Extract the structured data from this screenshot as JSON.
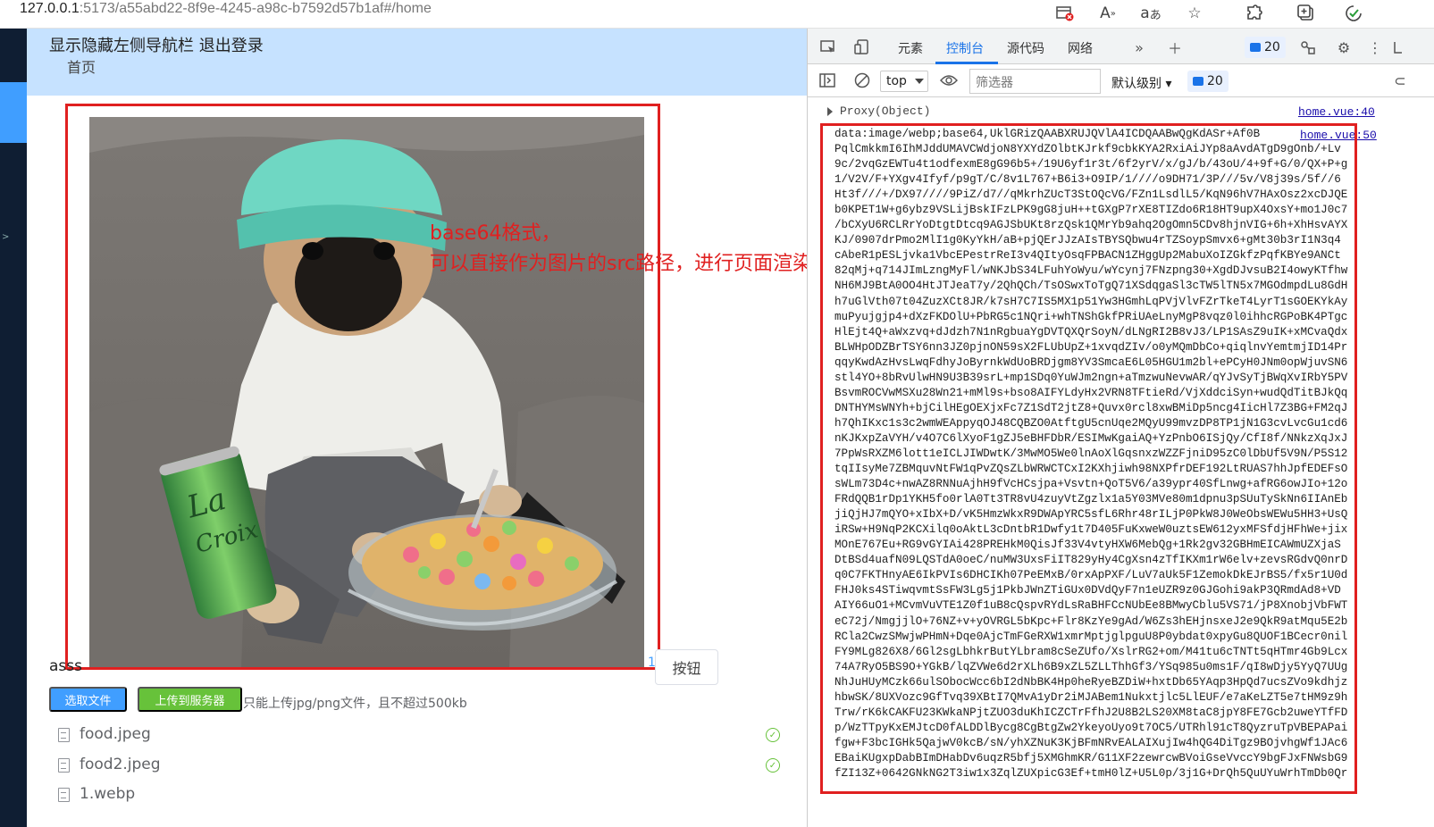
{
  "browser": {
    "url_host": "127.0.0.1",
    "url_rest": ":5173/a55abd22-8f9e-4245-a98c-b7592d57b1af#/home",
    "toolbar_icons": [
      "tab-close-icon",
      "read-aloud-icon",
      "translate-icon",
      "favorite-star-icon",
      "extensions-icon",
      "add-tab-icon",
      "browser-essentials-icon"
    ]
  },
  "app": {
    "header": {
      "toggle_nav": "显示隐藏左侧导航栏",
      "logout": "退出登录",
      "breadcrumb": "首页"
    },
    "caption_left": "asss",
    "caption_right": "1",
    "button_label": "按钮",
    "select_file_label": "选取文件",
    "upload_label": "上传到服务器",
    "upload_tip": "只能上传jpg/png文件，且不超过500kb",
    "files": [
      {
        "name": "food.jpeg",
        "status": "success"
      },
      {
        "name": "food2.jpeg",
        "status": "success"
      },
      {
        "name": "1.webp",
        "status": ""
      }
    ]
  },
  "annotations": {
    "left_line1": "base64格式，",
    "left_line2": "可以直接作为图片的src路径，进行页面渲染"
  },
  "devtools": {
    "tabs": [
      "元素",
      "控制台",
      "源代码",
      "网络"
    ],
    "active_tab": "控制台",
    "issue_count": "20",
    "context": "top",
    "filter_placeholder": "筛选器",
    "level": "默认级别",
    "message_count": "20",
    "log1_text": "Proxy(Object)",
    "log1_source": "home.vue:40",
    "log2_source": "home.vue:50",
    "base64_lines": [
      "data:image/webp;base64,UklGRizQAABXRUJQVlA4ICDQAABwQgKdASr+Af0B",
      "PqlCmkkmI6IhMJddUMAVCWdjoN8YXYdZOlbtKJrkf9cbkKYA2RxiAiJYp8aAvdATgD9gOnb/+Lv",
      "9c/2vqGzEWTu4t1odfexmE8gG96b5+/19U6yf1r3t/6f2yrV/x/gJ/b/43oU/4+9f+G/0/QX+P+g",
      "1/V2V/F+YXgv4Ifyf/p9gT/C/8v1L767+B6i3+O9IP/1////o9DH71/3P///5v/V8j39s/5f//6",
      "Ht3f///+/DX97////9PiZ/d7//qMkrhZUcT3StOQcVG/FZn1LsdlL5/KqN96hV7HAxOsz2xcDJQE",
      "b0KPET1W+g6ybz9VSLijBskIFzLPK9gG8juH++tGXgP7rXE8TIZdo6R18HT9upX4OxsY+mo1J0c7",
      "/bCXyU6RCLRrYoDtgtDtcq9AGJSbUKt8rzQsk1QMrYb9ahq2OgOmn5CDv8hjnVIG+6h+XhHsvAYX",
      "KJ/0907drPmo2MlI1g0KyYkH/aB+pjQErJJzAIsTBYSQbwu4rTZSoypSmvx6+gMt30b3rI1N3q4",
      "cAbeR1pESLjvka1VbcEPestrReI3v4QItyOsqFPBACN1ZHggUp2MabuXoIZGkfzPqfKBYe9ANCt",
      "82qMj+q714JImLzngMyFl/wNKJbS34LFuhYoWyu/wYcynj7FNzpng30+XgdDJvsuB2I4owyKTfhw",
      "NH6MJ9BtA0OO4HtJTJeaT7y/2QhQCh/TsOSwxToTgQ71XSdqgaSl3cTW5lTN5x7MGOdmpdLu8GdH",
      "h7uGlVth07t04ZuzXCt8JR/k7sH7C7IS5MX1p51Yw3HGmhLqPVjVlvFZrTkeT4LyrT1sGOEKYkAy",
      "muPyujgjp4+dXzFKDOlU+PbRG5c1NQri+whTNShGkfPRiUAeLnyMgP8vqz0l0ihhcRGPoBK4PTgc",
      "HlEjt4Q+aWxzvq+dJdzh7N1nRgbuaYgDVTQXQrSoyN/dLNgRI2B8vJ3/LP1SAsZ9uIK+xMCvaQdx",
      "BLWHpODZBrTSY6nn3JZ0pjnON59sX2FLUbUpZ+1xvqdZIv/o0yMQmDbCo+qiqlnvYemtmjID14Pr",
      "qqyKwdAzHvsLwqFdhyJoByrnkWdUoBRDjgm8YV3SmcaE6L05HGU1m2bl+ePCyH0JNm0opWjuvSN6",
      "stl4YO+8bRvUlwHN9U3B39srL+mp1SDq0YuWJm2ngn+aTmzwuNevwAR/qYJvSyTjBWqXvIRbY5PV",
      "BsvmROCVwMSXu28Wn21+mMl9s+bso8AIFYLdyHx2VRN8TFtieRd/VjXddciSyn+wudQdTitBJkQq",
      "DNTHYMsWNYh+bjCilHEgOEXjxFc7Z1SdT2jtZ8+Quvx0rcl8xwBMiDp5ncg4IicHl7Z3BG+FM2qJ",
      "h7QhIKxc1s3c2wmWEAppyqOJ48CQBZO0AtftgU5cnUqe2MQyU99mvzDP8TP1jN1G3cvLvcGu1cd6",
      "nKJKxpZaVYH/v4O7C6lXyoF1gZJ5eBHFDbR/ESIMwKgaiAQ+YzPnbO6ISjQy/CfI8f/NNkzXqJxJ",
      "7PpWsRXZM6lott1eICLJIWDwtK/3MwMO5We0lnAoXlGqsnxzWZZFjniD95zC0lDbUf5V9N/P5S12",
      "tqIIsyMe7ZBMquvNtFW1qPvZQsZLbWRWCTCxI2KXhjiwh98NXPfrDEF192LtRUAS7hhJpfEDEFsO",
      "sWLm73D4c+nwAZ8RNNuAjhH9fVcHCsjpa+Vsvtn+QoT5V6/a39ypr40SfLnwg+afRG6owJIo+12o",
      "FRdQQB1rDp1YKH5fo0rlA0Tt3TR8vU4zuyVtZgzlx1a5Y03MVe80m1dpnu3pSUuTySkNn6IIAnEb",
      "jiQjHJ7mQYO+xIbX+D/vK5HmzWkxR9DWApYRC5sfL6Rhr48rILjP0PkW8J0WeObsWEWu5HH3+UsQ",
      "iRSw+H9NqP2KCXilq0oAktL3cDntbR1Dwfy1t7D405FuKxweW0uztsEW612yxMFSfdjHFhWe+jix",
      "MOnE767Eu+RG9vGYIAi428PREHkM0QisJf33V4vtyHXW6MebQg+1Rk2gv32GBHmEICAWmUZXjaS",
      "DtBSd4uafN09LQSTdA0oeC/nuMW3UxsFiIT829yHy4CgXsn4zTfIKXm1rW6elv+zevsRGdvQ0nrD",
      "q0C7FKTHnyAE6IkPVIs6DHCIKh07PeEMxB/0rxApPXF/LuV7aUk5F1ZemokDkEJrBS5/fx5r1U0d",
      "FHJ0ks4STiwqvmtSsFW3Lg5j1PkbJWnZTiGUx0DVdQyF7n1eUZR9z0GJGohi9akP3QRmdAd8+VD",
      "AIY66uO1+MCvmVuVTE1Z0f1uB8cQspvRYdLsRaBHFCcNUbEe8BMwyCblu5VS71/jP8XnobjVbFWT",
      "eC72j/NmgjjlO+76NZ+v+yOVRGL5bKpc+Flr8KzYe9gAd/W6Zs3hEHjnsxeJ2e9QkR9atMqu5E2b",
      "RCla2CwzSMwjwPHmN+Dqe0AjcTmFGeRXW1xmrMptjglpguU8P0ybdat0xpyGu8QUOF1BCecr0nil",
      "FY9MLg826X8/6Gl2sgLbhkrButYLbram8cSeZUfo/XslrRG2+om/M41tu6cTNTt5qHTmr4Gb9Lcx",
      "74A7RyO5BS9O+YGkB/lqZVWe6d2rXLh6B9xZL5ZLLThhGf3/YSq985u0ms1F/qI8wDjy5YyQ7UUg",
      "NhJuHUyMCzk66ulSObocWcc6bI2dNbBK4Hp0heRyeBZDiW+hxtDb65YAqp3HpQd7ucsZVo9kdhjz",
      "hbwSK/8UXVozc9GfTvq39XBtI7QMvA1yDr2iMJABem1Nukxtjlc5LlEUF/e7aKeLZT5e7tHM9z9h",
      "Trw/rK6kCAKFU23KWkaNPjtZUO3duKhICZCTrFfhJ2U8B2LS20XM8taC8jpY8FE7Gcb2uweYTfFD",
      "p/WzTTpyKxEMJtcD0fALDDlBycg8CgBtgZw2YkeyoUyo9t7OC5/UTRhl91cT8QyzruTpVBEPAPai",
      "fgw+F3bcIGHk5QajwV0kcB/sN/yhXZNuK3KjBFmNRvEALAIXujIw4hQG4DiTgz9BOjvhgWf1JAc6",
      "EBaiKUgxpDabBImDHabDv6uqzR5bfj5XMGhmKR/G11XF2zewrcwBVoiGseVvccY9bgFJxFNWsbG9",
      "fZI13Z+0642GNkNG2T3iw1x3ZqlZUXpicG3Ef+tmH0lZ+U5L0p/3j1G+DrQh5QuUYuWrhTmDb0Qr"
    ]
  }
}
